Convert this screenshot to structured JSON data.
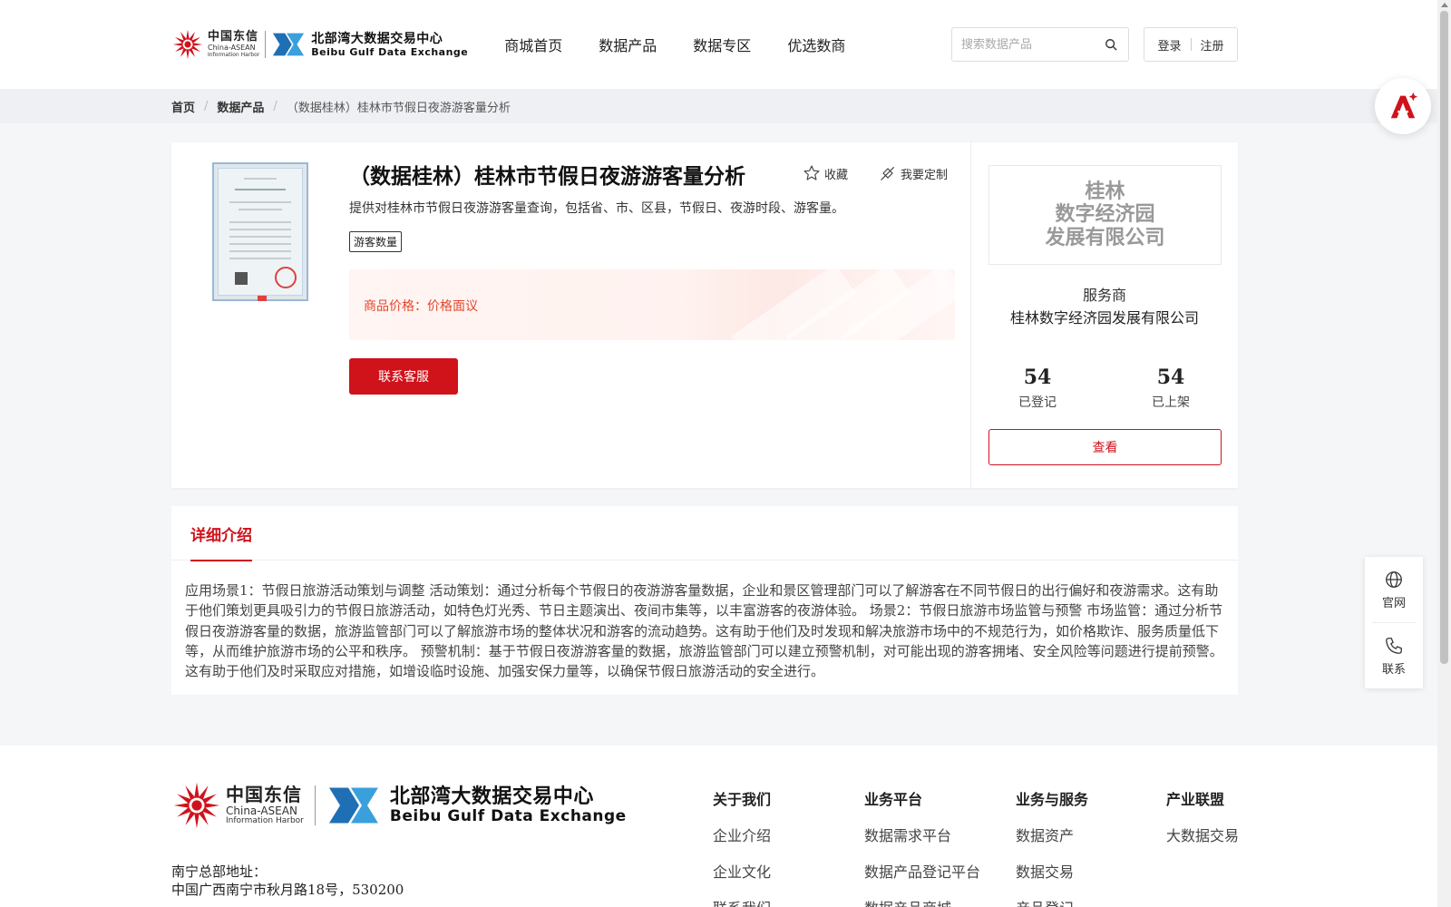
{
  "brand": {
    "cn_name": "中国东信",
    "cn_en": "China-ASEAN",
    "cn_en2": "Information Harbor",
    "bg_name": "北部湾大数据交易中心",
    "bg_en": "Beibu Gulf Data Exchange"
  },
  "nav": {
    "items": [
      "商城首页",
      "数据产品",
      "数据专区",
      "优选数商"
    ]
  },
  "search": {
    "placeholder": "搜索数据产品",
    "value": ""
  },
  "auth": {
    "login": "登录",
    "register": "注册"
  },
  "breadcrumb": {
    "home": "首页",
    "category": "数据产品",
    "sep": "/",
    "current": "（数据桂林）桂林市节假日夜游游客量分析"
  },
  "product": {
    "title": "（数据桂林）桂林市节假日夜游游客量分析",
    "favorite": "收藏",
    "customize": "我要定制",
    "description": "提供对桂林市节假日夜游游客量查询，包括省、市、区县，节假日、夜游时段、游客量。",
    "tag": "游客数量",
    "price_label": "商品价格：",
    "price_value": "价格面议",
    "contact_button": "联系客服"
  },
  "vendor": {
    "logo_lines": [
      "桂林",
      "数字经济园",
      "发展有限公司"
    ],
    "role": "服务商",
    "name": "桂林数字经济园发展有限公司",
    "registered_count": "54",
    "registered_label": "已登记",
    "listed_count": "54",
    "listed_label": "已上架",
    "view_button": "查看"
  },
  "detail": {
    "tab": "详细介绍",
    "body": "应用场景1：节假日旅游活动策划与调整 活动策划：通过分析每个节假日的夜游游客量数据，企业和景区管理部门可以了解游客在不同节假日的出行偏好和夜游需求。这有助于他们策划更具吸引力的节假日旅游活动，如特色灯光秀、节日主题演出、夜间市集等，以丰富游客的夜游体验。 场景2：节假日旅游市场监管与预警 市场监管：通过分析节假日夜游游客量的数据，旅游监管部门可以了解旅游市场的整体状况和游客的流动趋势。这有助于他们及时发现和解决旅游市场中的不规范行为，如价格欺诈、服务质量低下等，从而维护旅游市场的公平和秩序。 预警机制：基于节假日夜游游客量的数据，旅游监管部门可以建立预警机制，对可能出现的游客拥堵、安全风险等问题进行提前预警。这有助于他们及时采取应对措施，如增设临时设施、加强安保力量等，以确保节假日旅游活动的安全进行。"
  },
  "footer": {
    "address_label": "南宁总部地址：",
    "address": "中国广西南宁市秋月路18号，530200",
    "columns": [
      {
        "title": "关于我们",
        "items": [
          "企业介绍",
          "企业文化",
          "联系我们"
        ]
      },
      {
        "title": "业务平台",
        "items": [
          "数据需求平台",
          "数据产品登记平台",
          "数据产品商城"
        ]
      },
      {
        "title": "业务与服务",
        "items": [
          "数据资产",
          "数据交易",
          "产品登记"
        ]
      },
      {
        "title": "产业联盟",
        "items": [
          "大数据交易"
        ]
      }
    ]
  },
  "side": {
    "official": "官网",
    "contact": "联系"
  },
  "colors": {
    "accent": "#d0121b",
    "price": "#e5462b"
  }
}
